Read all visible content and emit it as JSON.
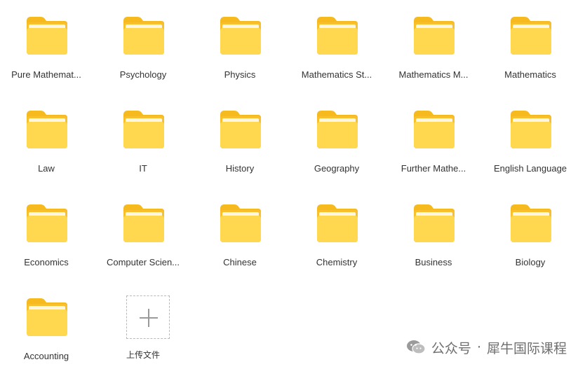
{
  "folders": [
    {
      "label": "Pure Mathemat..."
    },
    {
      "label": "Psychology"
    },
    {
      "label": "Physics"
    },
    {
      "label": "Mathematics St..."
    },
    {
      "label": "Mathematics M..."
    },
    {
      "label": "Mathematics"
    },
    {
      "label": "Law"
    },
    {
      "label": "IT"
    },
    {
      "label": "History"
    },
    {
      "label": "Geography"
    },
    {
      "label": "Further Mathe..."
    },
    {
      "label": "English Language"
    },
    {
      "label": "Economics"
    },
    {
      "label": "Computer Scien..."
    },
    {
      "label": "Chinese"
    },
    {
      "label": "Chemistry"
    },
    {
      "label": "Business"
    },
    {
      "label": "Biology"
    },
    {
      "label": "Accounting"
    }
  ],
  "upload": {
    "label": "上传文件",
    "icon": "plus-icon"
  },
  "watermark": {
    "prefix": "公众号",
    "separator": "·",
    "name": "犀牛国际课程",
    "icon": "wechat-icon"
  },
  "colors": {
    "folder_back": "#F8C02C",
    "folder_front": "#FFD84F",
    "folder_tab": "#F6B91E",
    "label_text": "#333333",
    "upload_border": "#B9B9B9"
  }
}
